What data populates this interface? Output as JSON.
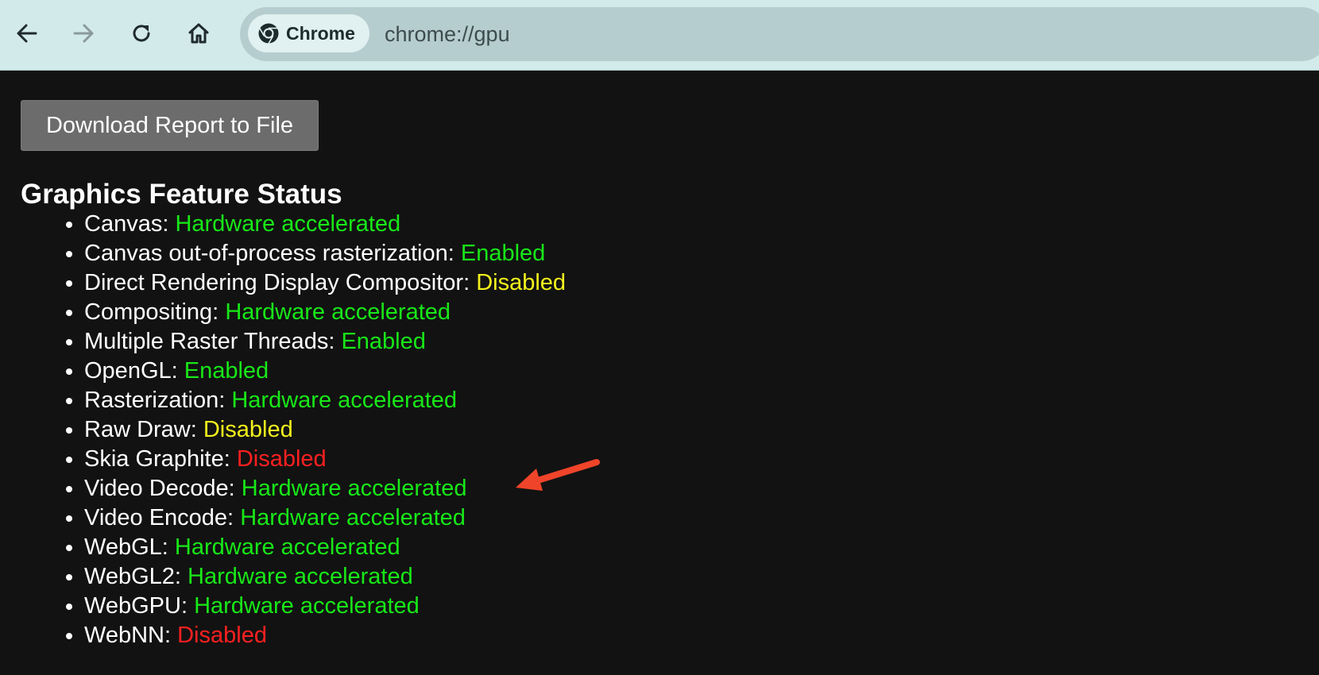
{
  "browser": {
    "nav": {
      "back_icon": "arrow-left-icon",
      "forward_icon": "arrow-right-icon",
      "reload_icon": "reload-icon",
      "home_icon": "home-icon"
    },
    "omnibox": {
      "chip_label": "Chrome",
      "chip_icon": "chrome-logo-icon",
      "url": "chrome://gpu"
    }
  },
  "page": {
    "download_button_label": "Download Report to File",
    "section_title": "Graphics Feature Status",
    "features": [
      {
        "label": "Canvas: ",
        "status": "Hardware accelerated",
        "level": "ok"
      },
      {
        "label": "Canvas out-of-process rasterization: ",
        "status": "Enabled",
        "level": "ok"
      },
      {
        "label": "Direct Rendering Display Compositor: ",
        "status": "Disabled",
        "level": "warn"
      },
      {
        "label": "Compositing: ",
        "status": "Hardware accelerated",
        "level": "ok"
      },
      {
        "label": "Multiple Raster Threads: ",
        "status": "Enabled",
        "level": "ok"
      },
      {
        "label": "OpenGL: ",
        "status": "Enabled",
        "level": "ok"
      },
      {
        "label": "Rasterization: ",
        "status": "Hardware accelerated",
        "level": "ok"
      },
      {
        "label": "Raw Draw: ",
        "status": "Disabled",
        "level": "warn"
      },
      {
        "label": "Skia Graphite: ",
        "status": "Disabled",
        "level": "bad"
      },
      {
        "label": "Video Decode: ",
        "status": "Hardware accelerated",
        "level": "ok"
      },
      {
        "label": "Video Encode: ",
        "status": "Hardware accelerated",
        "level": "ok"
      },
      {
        "label": "WebGL: ",
        "status": "Hardware accelerated",
        "level": "ok"
      },
      {
        "label": "WebGL2: ",
        "status": "Hardware accelerated",
        "level": "ok"
      },
      {
        "label": "WebGPU: ",
        "status": "Hardware accelerated",
        "level": "ok"
      },
      {
        "label": "WebNN: ",
        "status": "Disabled",
        "level": "bad"
      }
    ]
  },
  "colors": {
    "toolbar_bg": "#d3eaea",
    "omnibox_bg": "#b6cdcf",
    "page_bg": "#121212",
    "status_ok": "#18e818",
    "status_warn": "#f3f31c",
    "status_bad": "#ff2020",
    "annotation_arrow": "#f0442a"
  },
  "annotation": {
    "arrow_icon": "red-arrow-icon",
    "points_to_feature": "Video Decode"
  }
}
